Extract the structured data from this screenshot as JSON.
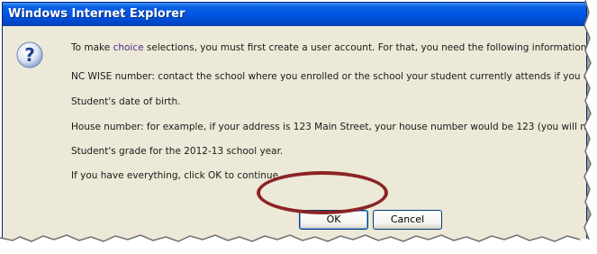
{
  "window": {
    "title": "Windows Internet Explorer"
  },
  "icon": {
    "name": "question-icon",
    "glyph": "?"
  },
  "message": {
    "line1_before": "To make ",
    "line1_link": "choice",
    "line1_after": " selections, you must first create a user account. For that, you need the following information:",
    "line2": "NC WISE number: contact the school where you enrolled or the school your student currently attends if you do",
    "line3": "Student's date of birth.",
    "line4": "House number: for example, if your address is 123 Main Street, your house number would be 123 (you will not",
    "line5": "Student's grade for the 2012-13 school year.",
    "line6": "If you have everything, click OK to continue."
  },
  "buttons": {
    "ok": "OK",
    "cancel": "Cancel"
  },
  "colors": {
    "titlebar": "#0055e5",
    "dialog_bg": "#ece9d8",
    "highlight_ring": "#8b2424",
    "link": "#4b2e8c"
  }
}
